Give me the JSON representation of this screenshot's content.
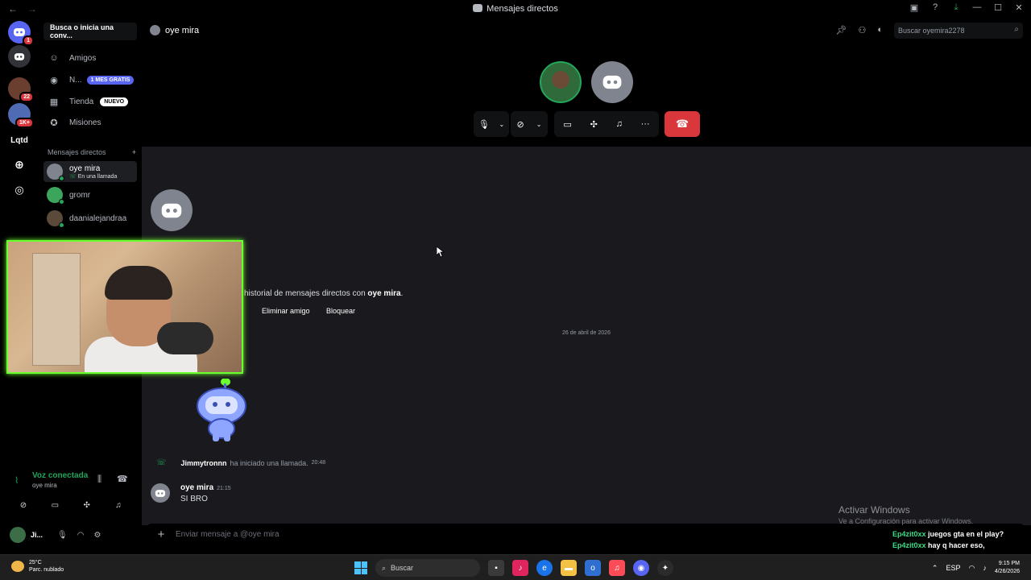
{
  "titlebar": {
    "back": "←",
    "forward": "→",
    "title": "Mensajes directos"
  },
  "rail": {
    "servers": [
      {
        "label": "",
        "badge": "1",
        "color": "#5865f2"
      },
      {
        "label": "",
        "badge": "",
        "color": "#313338"
      },
      {
        "label": "",
        "badge": "22",
        "color": "#6b3f2f"
      },
      {
        "label": "",
        "badge": "1K+",
        "color": "#4e6bb3"
      },
      {
        "label": "Lqtd",
        "badge": "",
        "color": "#000000"
      }
    ]
  },
  "sidebar": {
    "search": "Busca o inicia una conv...",
    "nav": [
      {
        "label": "Amigos",
        "pill": ""
      },
      {
        "label": "N...",
        "pill": "1 MES GRATIS"
      },
      {
        "label": "Tienda",
        "pill": "NUEVO"
      },
      {
        "label": "Misiones",
        "pill": ""
      }
    ],
    "dm_header": "Mensajes directos",
    "dm_add": "+",
    "dms": [
      {
        "name": "oye mira",
        "sub": "En una llamada"
      },
      {
        "name": "gromr",
        "sub": ""
      },
      {
        "name": "daanialejandraa",
        "sub": ""
      }
    ]
  },
  "voice": {
    "title": "Voz conectada",
    "sub": "oye mira",
    "user": "Ji..."
  },
  "header": {
    "channel": "oye mira",
    "search_placeholder": "Buscar oyemira2278"
  },
  "chat": {
    "history_prefix": "historial de mensajes directos con ",
    "history_name": "oye mira",
    "history_suffix": ".",
    "remove_friend": "Eliminar amigo",
    "block": "Bloquear",
    "date": "26 de abril de 2026",
    "call_user": "Jimmytronnn",
    "call_text": "ha iniciado una llamada.",
    "call_time": "20:48",
    "msg_author": "oye mira",
    "msg_time": "21:15",
    "msg_text": "SI BRO",
    "composer_placeholder": "Enviar mensaje a @oye mira"
  },
  "watermark": {
    "line1": "Activar Windows",
    "line2": "Ve a Configuración para activar Windows."
  },
  "stream_chat": [
    {
      "user": "Ep4zit0xx",
      "text": "juegos gta en el play?"
    },
    {
      "user": "Ep4zit0xx",
      "text": "hay q hacer eso,"
    }
  ],
  "taskbar": {
    "temp": "25°C",
    "weather": "Parc. nublado",
    "search": "Buscar",
    "lang": "ESP",
    "time": "9:15 PM",
    "date": "4/26/2026"
  },
  "colors": {
    "accent": "#5865f2",
    "online": "#23a55a",
    "danger": "#da373c",
    "webcam_border": "#6cff2e"
  }
}
